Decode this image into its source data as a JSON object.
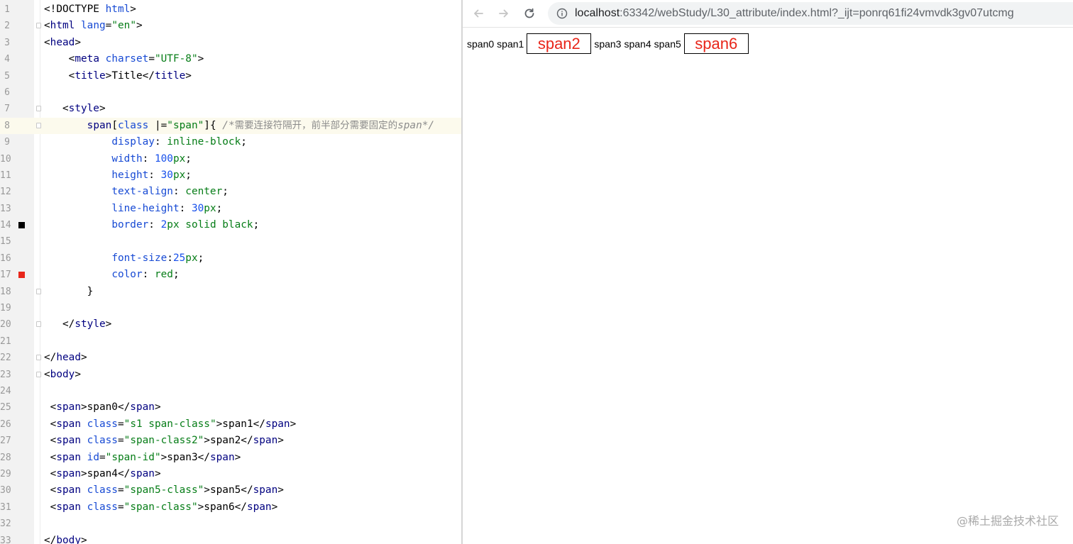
{
  "editor": {
    "lines": [
      {
        "n": "1",
        "tokens": [
          [
            "t-plain",
            "<!DOCTYPE "
          ],
          [
            "t-attr",
            "html"
          ],
          [
            "t-plain",
            ">"
          ]
        ]
      },
      {
        "n": "2",
        "fold": true,
        "tokens": [
          [
            "t-plain",
            "<"
          ],
          [
            "t-tag",
            "html "
          ],
          [
            "t-attr",
            "lang"
          ],
          [
            "t-plain",
            "="
          ],
          [
            "t-str",
            "\"en\""
          ],
          [
            "t-plain",
            ">"
          ]
        ]
      },
      {
        "n": "3",
        "tokens": [
          [
            "t-plain",
            "<"
          ],
          [
            "t-tag",
            "head"
          ],
          [
            "t-plain",
            ">"
          ]
        ]
      },
      {
        "n": "4",
        "tokens": [
          [
            "t-plain",
            "    <"
          ],
          [
            "t-tag",
            "meta "
          ],
          [
            "t-attr",
            "charset"
          ],
          [
            "t-plain",
            "="
          ],
          [
            "t-str",
            "\"UTF-8\""
          ],
          [
            "t-plain",
            ">"
          ]
        ]
      },
      {
        "n": "5",
        "tokens": [
          [
            "t-plain",
            "    <"
          ],
          [
            "t-tag",
            "title"
          ],
          [
            "t-plain",
            ">Title</"
          ],
          [
            "t-tag",
            "title"
          ],
          [
            "t-plain",
            ">"
          ]
        ]
      },
      {
        "n": "6",
        "tokens": []
      },
      {
        "n": "7",
        "fold": true,
        "tokens": [
          [
            "t-plain",
            "   <"
          ],
          [
            "t-tag",
            "style"
          ],
          [
            "t-plain",
            ">"
          ]
        ]
      },
      {
        "n": "8",
        "fold": true,
        "current": true,
        "tokens": [
          [
            "t-plain",
            "       "
          ],
          [
            "t-tag",
            "span"
          ],
          [
            "t-plain",
            "["
          ],
          [
            "t-attr",
            "class "
          ],
          [
            "t-plain",
            "|="
          ],
          [
            "t-str",
            "\"span\""
          ],
          [
            "t-plain",
            "]{ "
          ],
          [
            "t-cmt",
            "/*"
          ],
          [
            "t-cmt-cn",
            "需要连接符隔开，前半部分需要固定的"
          ],
          [
            "t-cmt",
            "span*/"
          ]
        ]
      },
      {
        "n": "9",
        "tokens": [
          [
            "t-plain",
            "           "
          ],
          [
            "t-prop",
            "display"
          ],
          [
            "t-plain",
            ": "
          ],
          [
            "t-val",
            "inline-block"
          ],
          [
            "t-plain",
            ";"
          ]
        ]
      },
      {
        "n": "10",
        "tokens": [
          [
            "t-plain",
            "           "
          ],
          [
            "t-prop",
            "width"
          ],
          [
            "t-plain",
            ": "
          ],
          [
            "t-num",
            "100"
          ],
          [
            "t-val",
            "px"
          ],
          [
            "t-plain",
            ";"
          ]
        ]
      },
      {
        "n": "11",
        "tokens": [
          [
            "t-plain",
            "           "
          ],
          [
            "t-prop",
            "height"
          ],
          [
            "t-plain",
            ": "
          ],
          [
            "t-num",
            "30"
          ],
          [
            "t-val",
            "px"
          ],
          [
            "t-plain",
            ";"
          ]
        ]
      },
      {
        "n": "12",
        "tokens": [
          [
            "t-plain",
            "           "
          ],
          [
            "t-prop",
            "text-align"
          ],
          [
            "t-plain",
            ": "
          ],
          [
            "t-val",
            "center"
          ],
          [
            "t-plain",
            ";"
          ]
        ]
      },
      {
        "n": "13",
        "tokens": [
          [
            "t-plain",
            "           "
          ],
          [
            "t-prop",
            "line-height"
          ],
          [
            "t-plain",
            ": "
          ],
          [
            "t-num",
            "30"
          ],
          [
            "t-val",
            "px"
          ],
          [
            "t-plain",
            ";"
          ]
        ]
      },
      {
        "n": "14",
        "marker": "#000000",
        "tokens": [
          [
            "t-plain",
            "           "
          ],
          [
            "t-prop",
            "border"
          ],
          [
            "t-plain",
            ": "
          ],
          [
            "t-num",
            "2"
          ],
          [
            "t-val",
            "px solid black"
          ],
          [
            "t-plain",
            ";"
          ]
        ]
      },
      {
        "n": "15",
        "tokens": []
      },
      {
        "n": "16",
        "tokens": [
          [
            "t-plain",
            "           "
          ],
          [
            "t-prop",
            "font-size"
          ],
          [
            "t-plain",
            ":"
          ],
          [
            "t-num",
            "25"
          ],
          [
            "t-val",
            "px"
          ],
          [
            "t-plain",
            ";"
          ]
        ]
      },
      {
        "n": "17",
        "marker": "#e8261a",
        "tokens": [
          [
            "t-plain",
            "           "
          ],
          [
            "t-prop",
            "color"
          ],
          [
            "t-plain",
            ": "
          ],
          [
            "t-val",
            "red"
          ],
          [
            "t-plain",
            ";"
          ]
        ]
      },
      {
        "n": "18",
        "fold": true,
        "tokens": [
          [
            "t-plain",
            "       }"
          ]
        ]
      },
      {
        "n": "19",
        "tokens": []
      },
      {
        "n": "20",
        "fold": true,
        "tokens": [
          [
            "t-plain",
            "   </"
          ],
          [
            "t-tag",
            "style"
          ],
          [
            "t-plain",
            ">"
          ]
        ]
      },
      {
        "n": "21",
        "tokens": []
      },
      {
        "n": "22",
        "fold": true,
        "tokens": [
          [
            "t-plain",
            "</"
          ],
          [
            "t-tag",
            "head"
          ],
          [
            "t-plain",
            ">"
          ]
        ]
      },
      {
        "n": "23",
        "fold": true,
        "tokens": [
          [
            "t-plain",
            "<"
          ],
          [
            "t-tag",
            "body"
          ],
          [
            "t-plain",
            ">"
          ]
        ]
      },
      {
        "n": "24",
        "tokens": []
      },
      {
        "n": "25",
        "tokens": [
          [
            "t-plain",
            " <"
          ],
          [
            "t-tag",
            "span"
          ],
          [
            "t-plain",
            ">span0</"
          ],
          [
            "t-tag",
            "span"
          ],
          [
            "t-plain",
            ">"
          ]
        ]
      },
      {
        "n": "26",
        "tokens": [
          [
            "t-plain",
            " <"
          ],
          [
            "t-tag",
            "span "
          ],
          [
            "t-attr",
            "class"
          ],
          [
            "t-plain",
            "="
          ],
          [
            "t-str",
            "\"s1 span-class\""
          ],
          [
            "t-plain",
            ">span1</"
          ],
          [
            "t-tag",
            "span"
          ],
          [
            "t-plain",
            ">"
          ]
        ]
      },
      {
        "n": "27",
        "tokens": [
          [
            "t-plain",
            " <"
          ],
          [
            "t-tag",
            "span "
          ],
          [
            "t-attr",
            "class"
          ],
          [
            "t-plain",
            "="
          ],
          [
            "t-str",
            "\"span-class2\""
          ],
          [
            "t-plain",
            ">span2</"
          ],
          [
            "t-tag",
            "span"
          ],
          [
            "t-plain",
            ">"
          ]
        ]
      },
      {
        "n": "28",
        "tokens": [
          [
            "t-plain",
            " <"
          ],
          [
            "t-tag",
            "span "
          ],
          [
            "t-attr",
            "id"
          ],
          [
            "t-plain",
            "="
          ],
          [
            "t-str",
            "\"span-id\""
          ],
          [
            "t-plain",
            ">span3</"
          ],
          [
            "t-tag",
            "span"
          ],
          [
            "t-plain",
            ">"
          ]
        ]
      },
      {
        "n": "29",
        "tokens": [
          [
            "t-plain",
            " <"
          ],
          [
            "t-tag",
            "span"
          ],
          [
            "t-plain",
            ">span4</"
          ],
          [
            "t-tag",
            "span"
          ],
          [
            "t-plain",
            ">"
          ]
        ]
      },
      {
        "n": "30",
        "tokens": [
          [
            "t-plain",
            " <"
          ],
          [
            "t-tag",
            "span "
          ],
          [
            "t-attr",
            "class"
          ],
          [
            "t-plain",
            "="
          ],
          [
            "t-str",
            "\"span5-class\""
          ],
          [
            "t-plain",
            ">span5</"
          ],
          [
            "t-tag",
            "span"
          ],
          [
            "t-plain",
            ">"
          ]
        ]
      },
      {
        "n": "31",
        "tokens": [
          [
            "t-plain",
            " <"
          ],
          [
            "t-tag",
            "span "
          ],
          [
            "t-attr",
            "class"
          ],
          [
            "t-plain",
            "="
          ],
          [
            "t-str",
            "\"span-class\""
          ],
          [
            "t-plain",
            ">span6</"
          ],
          [
            "t-tag",
            "span"
          ],
          [
            "t-plain",
            ">"
          ]
        ]
      },
      {
        "n": "32",
        "tokens": []
      },
      {
        "n": "33",
        "tokens": [
          [
            "t-plain",
            "</"
          ],
          [
            "t-tag",
            "body"
          ],
          [
            "t-plain",
            ">"
          ]
        ]
      }
    ]
  },
  "browser": {
    "url_host": "localhost",
    "url_rest": ":63342/webStudy/L30_attribute/index.html?_ijt=ponrq61fi24vmvdk3gv07utcmg",
    "icons": {
      "back": "back-arrow-icon",
      "forward": "forward-arrow-icon",
      "reload": "reload-icon",
      "info": "info-icon"
    },
    "rendered": [
      {
        "text": "span0",
        "boxed": false
      },
      {
        "text": "span1",
        "boxed": false
      },
      {
        "text": "span2",
        "boxed": true
      },
      {
        "text": "span3",
        "boxed": false
      },
      {
        "text": "span4",
        "boxed": false
      },
      {
        "text": "span5",
        "boxed": false
      },
      {
        "text": "span6",
        "boxed": true
      }
    ],
    "box_color": "#e8261a"
  },
  "watermark": "@稀土掘金技术社区"
}
